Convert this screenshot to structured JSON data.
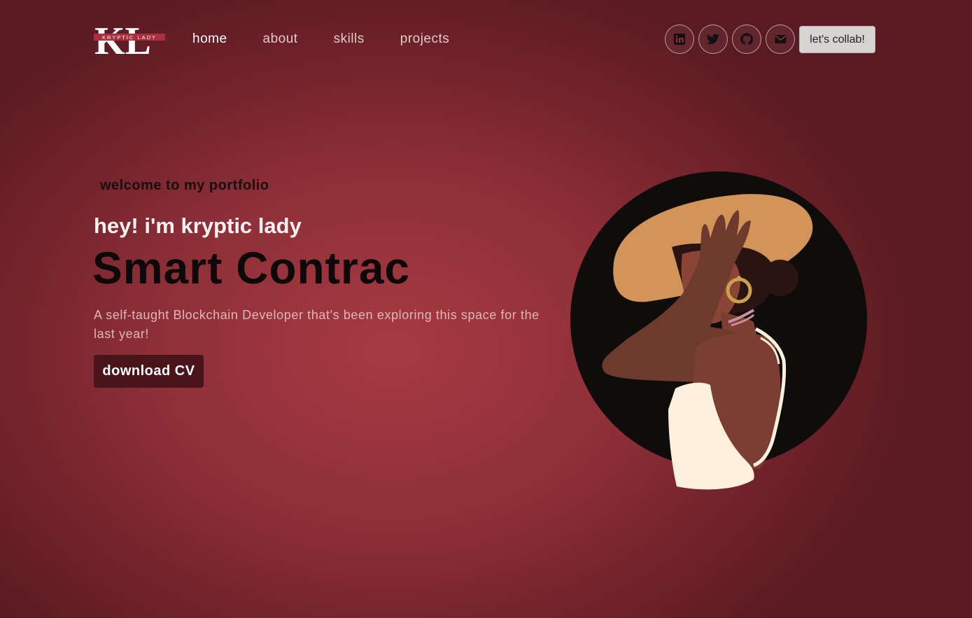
{
  "brand": {
    "logo_letters": "KL",
    "logo_text": "KRYPTIC LADY"
  },
  "nav": [
    {
      "label": "home"
    },
    {
      "label": "about"
    },
    {
      "label": "skills"
    },
    {
      "label": "projects"
    }
  ],
  "social": [
    {
      "icon": "linkedin-icon"
    },
    {
      "icon": "twitter-icon"
    },
    {
      "icon": "github-icon"
    },
    {
      "icon": "mail-icon"
    }
  ],
  "collab_label": "let's collab!",
  "hero": {
    "welcome": "welcome to my portfolio",
    "greeting": "hey! i'm kryptic lady",
    "typing_text": "Smart Contrac",
    "description": "A self-taught Blockchain Developer that's been exploring this space for the last year!",
    "cv_button": "download CV",
    "illustration": "woman-with-hat-illustration"
  },
  "colors": {
    "background": "#a63a42",
    "button_dark": "#4a141b",
    "collab_bg": "#d7d3d3",
    "skin": "#7a3e32",
    "hat": "#d39459"
  }
}
